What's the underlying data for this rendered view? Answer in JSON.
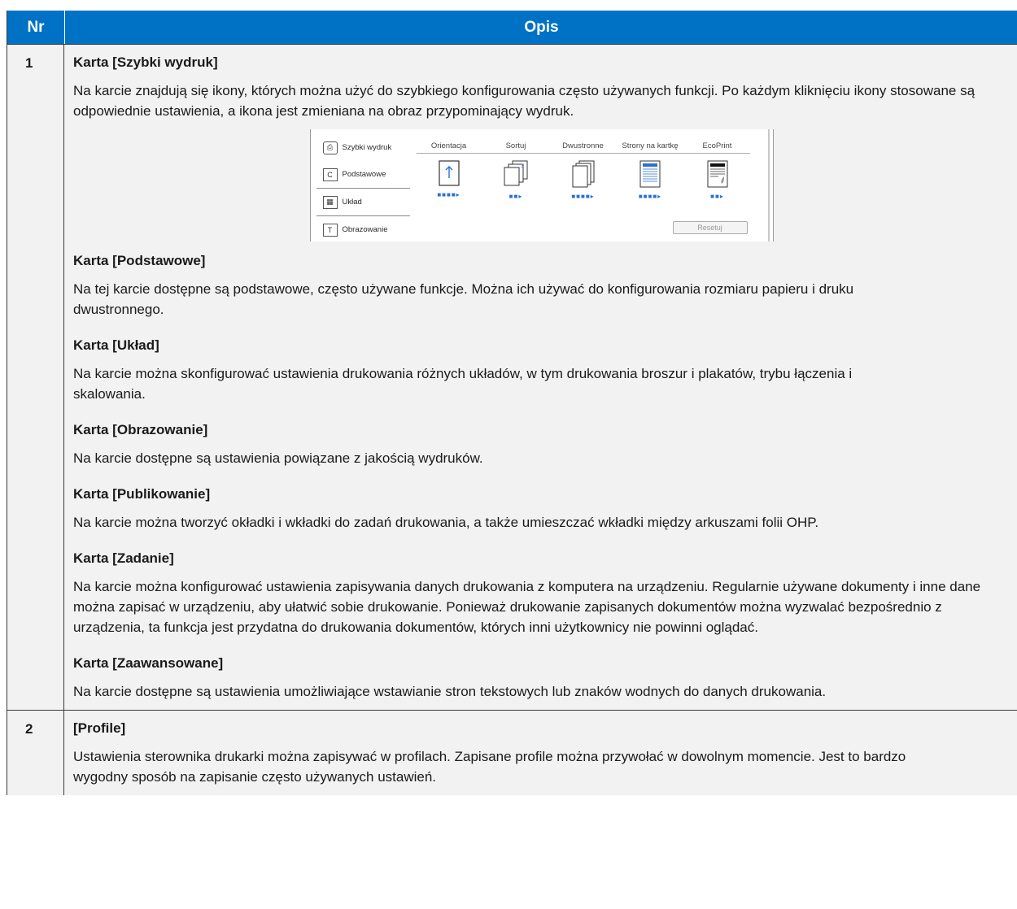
{
  "header": {
    "nr": "Nr",
    "opis": "Opis"
  },
  "rows": [
    {
      "nr": "1",
      "sections": [
        {
          "title": "Karta [Szybki wydruk]",
          "text": "Na karcie znajdują się ikony, których można użyć do szybkiego konfigurowania często używanych funkcji. Po każdym kliknięciu ikony stosowane są odpowiednie ustawienia, a ikona jest zmieniana na obraz przypominający wydruk."
        },
        {
          "title": "Karta [Podstawowe]",
          "text": "Na tej karcie dostępne są podstawowe, często używane funkcje. Można ich używać do konfigurowania rozmiaru papieru i druku dwustronnego."
        },
        {
          "title": "Karta [Układ]",
          "text": "Na karcie można skonfigurować ustawienia drukowania różnych układów, w tym drukowania broszur i plakatów, trybu łączenia i skalowania."
        },
        {
          "title": "Karta [Obrazowanie]",
          "text": "Na karcie dostępne są ustawienia powiązane z jakością wydruków."
        },
        {
          "title": "Karta [Publikowanie]",
          "text": "Na karcie można tworzyć okładki i wkładki do zadań drukowania, a także umieszczać wkładki między arkuszami folii OHP."
        },
        {
          "title": "Karta [Zadanie]",
          "text": "Na karcie można konfigurować ustawienia zapisywania danych drukowania z komputera na urządzeniu. Regularnie używane dokumenty i inne dane można zapisać w urządzeniu, aby ułatwić sobie drukowanie. Ponieważ drukowanie zapisanych dokumentów można wyzwalać bezpośrednio z urządzenia, ta funkcja jest przydatna do drukowania dokumentów, których inni użytkownicy nie powinni oglądać."
        },
        {
          "title": "Karta [Zaawansowane]",
          "text": "Na karcie dostępne są ustawienia umożliwiające wstawianie stron tekstowych lub znaków wodnych do danych drukowania."
        }
      ]
    },
    {
      "nr": "2",
      "sections": [
        {
          "title": "[Profile]",
          "text": "Ustawienia sterownika drukarki można zapisywać w profilach. Zapisane profile można przywołać w dowolnym momencie. Jest to bardzo wygodny sposób na zapisanie często używanych ustawień."
        }
      ]
    }
  ],
  "driver_screenshot": {
    "tabs": [
      {
        "label": "Szybki wydruk",
        "icon": "quick-print-icon"
      },
      {
        "label": "Podstawowe",
        "icon": "basic-icon"
      },
      {
        "label": "Układ",
        "icon": "layout-icon"
      },
      {
        "label": "Obrazowanie",
        "icon": "imaging-icon"
      }
    ],
    "columns": [
      "Orientacja",
      "Sortuj",
      "Dwustronne",
      "Strony na kartkę",
      "EcoPrint"
    ],
    "reset_label": "Resetuj",
    "accent": "#2a6fd4"
  },
  "colors": {
    "header_bg": "#0072c6",
    "row_bg": "#f2f2f2"
  }
}
